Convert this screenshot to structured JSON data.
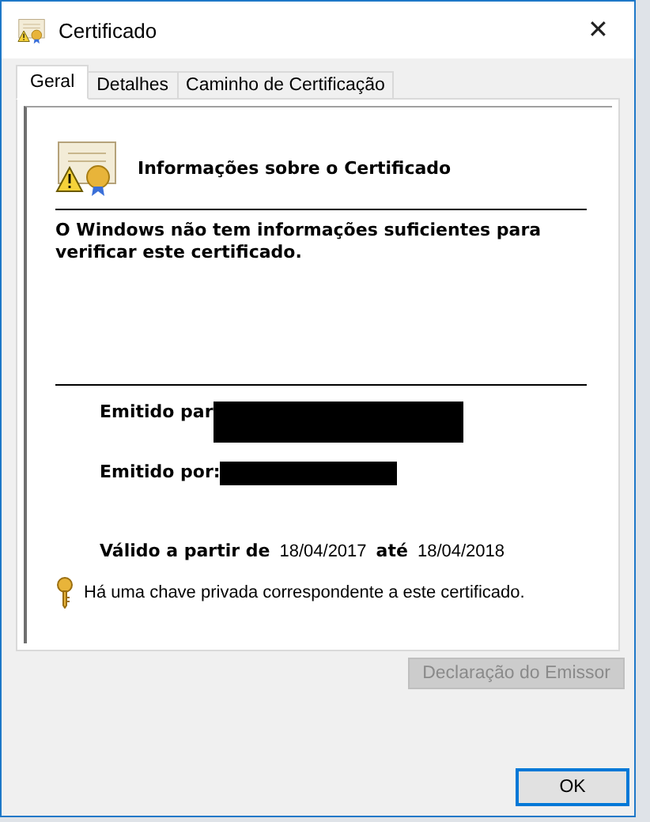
{
  "window": {
    "title": "Certificado",
    "close": "✕"
  },
  "tabs": [
    {
      "label": "Geral",
      "selected": true
    },
    {
      "label": "Detalhes",
      "selected": false
    },
    {
      "label": "Caminho de Certificação",
      "selected": false
    }
  ],
  "info": {
    "heading": "Informações sobre o Certificado",
    "message": "O Windows não tem informações suficientes para verificar este certificado."
  },
  "fields": [
    {
      "label": "Emitido par",
      "redacted": true
    },
    {
      "label": "Emitido por:",
      "redacted": true
    }
  ],
  "validity": {
    "from_label": "Válido a partir de",
    "from": "18/04/2017",
    "to_label": "até",
    "to": "18/04/2018"
  },
  "private_key_note": "Há uma chave privada correspondente a este certificado.",
  "issuer_button": {
    "label": "Declaração do Emissor",
    "disabled": true
  },
  "ok_button": {
    "label": "OK"
  }
}
